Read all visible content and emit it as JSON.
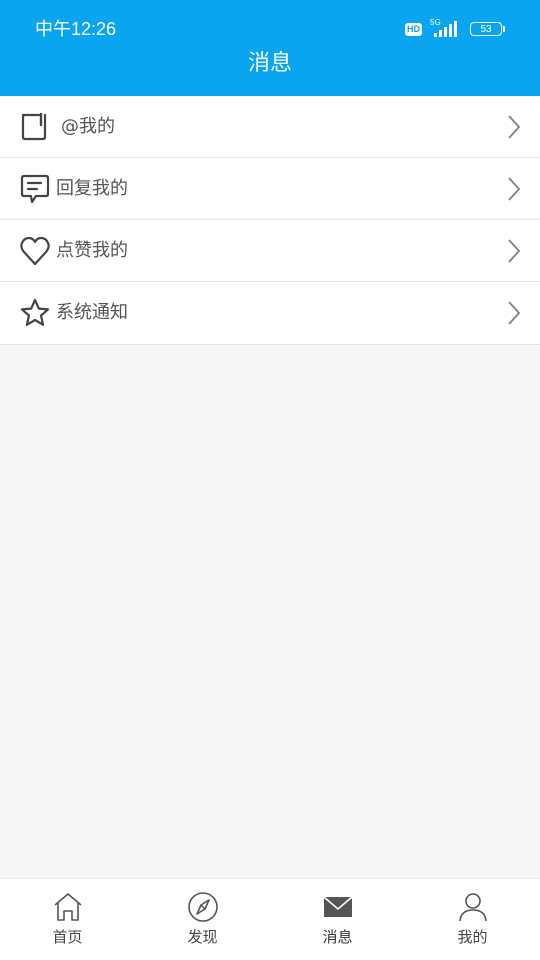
{
  "status_bar": {
    "time": "中午12:26",
    "hd": "HD",
    "network": "5G",
    "battery": "53"
  },
  "header": {
    "title": "消息"
  },
  "menu": {
    "items": [
      {
        "label": "@我的",
        "icon": "at-mention-icon"
      },
      {
        "label": "回复我的",
        "icon": "comment-icon"
      },
      {
        "label": "点赞我的",
        "icon": "heart-icon"
      },
      {
        "label": "系统通知",
        "icon": "star-icon"
      }
    ]
  },
  "tabbar": {
    "tabs": [
      {
        "label": "首页",
        "icon": "home-icon"
      },
      {
        "label": "发现",
        "icon": "compass-icon"
      },
      {
        "label": "消息",
        "icon": "mail-icon",
        "active": true
      },
      {
        "label": "我的",
        "icon": "user-icon"
      }
    ]
  },
  "colors": {
    "header_bg": "#0aa5f0",
    "page_bg": "#f7f7f7",
    "icon": "#444444",
    "active_tab_icon": "#555555"
  }
}
